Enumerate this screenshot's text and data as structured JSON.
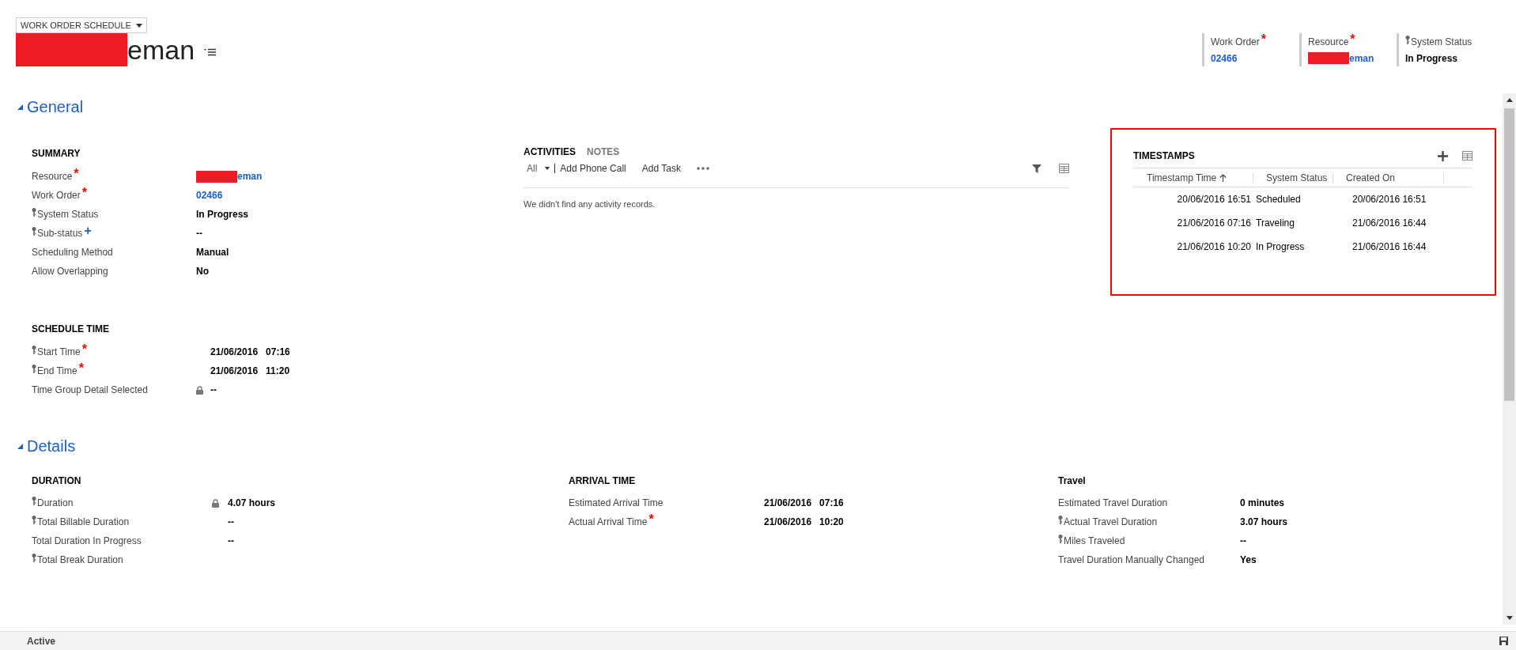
{
  "header": {
    "form_selector": "WORK ORDER SCHEDULE",
    "title": "eman",
    "title_redacted": true,
    "fields": [
      {
        "label": "Work Order",
        "mark": {
          "text": "*",
          "color": "#ff0000"
        },
        "key_icon": false,
        "value": "02466",
        "kind": "link",
        "redacted": false
      },
      {
        "label": "Resource",
        "mark": {
          "text": "*",
          "color": "#ff0000"
        },
        "key_icon": false,
        "value": "eman",
        "kind": "link",
        "redacted": true
      },
      {
        "label": "System Status",
        "key_icon": true,
        "value": "In Progress",
        "kind": "text",
        "redacted": false
      }
    ]
  },
  "general": {
    "title": "General",
    "expanded": true,
    "summary": {
      "title": "SUMMARY",
      "fields": [
        {
          "label": "Resource",
          "mark": {
            "text": "*",
            "color": "#ff0000"
          },
          "key_icon": false,
          "locked": false,
          "value": "eman",
          "kind": "link",
          "redacted": true
        },
        {
          "label": "Work Order",
          "mark": {
            "text": "*",
            "color": "#ff0000"
          },
          "key_icon": false,
          "locked": false,
          "value": "02466",
          "kind": "link",
          "redacted": false
        },
        {
          "label": "System Status",
          "key_icon": true,
          "locked": false,
          "value": "In Progress",
          "kind": "text",
          "redacted": false
        },
        {
          "label": "Sub-status",
          "mark": {
            "text": "+",
            "color": "#1e5ec8"
          },
          "key_icon": true,
          "locked": false,
          "value": "--",
          "kind": "text",
          "redacted": false
        },
        {
          "label": "Scheduling Method",
          "key_icon": false,
          "locked": false,
          "value": "Manual",
          "kind": "text",
          "redacted": false
        },
        {
          "label": "Allow Overlapping",
          "key_icon": false,
          "locked": false,
          "value": "No",
          "kind": "text",
          "redacted": false
        }
      ]
    },
    "schedule_time": {
      "title": "SCHEDULE TIME",
      "fields": [
        {
          "label": "Start Time",
          "mark": {
            "text": "*",
            "color": "#ff0000"
          },
          "key_icon": true,
          "locked": false,
          "value": "21/06/2016   07:16",
          "kind": "text",
          "redacted": false
        },
        {
          "label": "End Time",
          "mark": {
            "text": "*",
            "color": "#ff0000"
          },
          "key_icon": true,
          "locked": false,
          "value": "21/06/2016   11:20",
          "kind": "text",
          "redacted": false
        },
        {
          "label": "Time Group Detail Selected",
          "key_icon": false,
          "locked": true,
          "value": "--",
          "kind": "text",
          "redacted": false
        }
      ]
    },
    "activities": {
      "tabs": [
        {
          "label": "ACTIVITIES",
          "selected": true
        },
        {
          "label": "NOTES",
          "selected": false
        }
      ],
      "filter": "All",
      "actions": [
        "Add Phone Call",
        "Add Task"
      ],
      "empty_message": "We didn't find any activity records."
    },
    "timestamps": {
      "title": "TIMESTAMPS",
      "highlighted": true,
      "columns": [
        {
          "label": "Timestamp Time",
          "sorted": true
        },
        {
          "label": "System Status",
          "sorted": false
        },
        {
          "label": "Created On",
          "sorted": false
        }
      ],
      "rows": [
        [
          "20/06/2016 16:51",
          "Scheduled",
          "20/06/2016 16:51"
        ],
        [
          "21/06/2016 07:16",
          "Traveling",
          "21/06/2016 16:44"
        ],
        [
          "21/06/2016 10:20",
          "In Progress",
          "21/06/2016 16:44"
        ]
      ]
    }
  },
  "details": {
    "title": "Details",
    "expanded": true,
    "sections": [
      {
        "title": "DURATION",
        "fields": [
          {
            "label": "Duration",
            "key_icon": true,
            "locked": true,
            "value": "4.07 hours",
            "kind": "text",
            "redacted": false
          },
          {
            "label": "Total Billable Duration",
            "key_icon": true,
            "locked": false,
            "value": "--",
            "kind": "text",
            "redacted": false
          },
          {
            "label": "Total Duration In Progress",
            "key_icon": false,
            "locked": false,
            "value": "--",
            "kind": "text",
            "redacted": false
          },
          {
            "label": "Total Break Duration",
            "key_icon": true,
            "locked": false,
            "redacted": false
          }
        ]
      },
      {
        "title": "ARRIVAL TIME",
        "fields": [
          {
            "label": "Estimated Arrival Time",
            "key_icon": false,
            "locked": false,
            "value": "21/06/2016   07:16",
            "kind": "text",
            "redacted": false
          },
          {
            "label": "Actual Arrival Time",
            "mark": {
              "text": "*",
              "color": "#ff0000"
            },
            "key_icon": false,
            "locked": false,
            "value": "21/06/2016   10:20",
            "kind": "text",
            "redacted": false
          }
        ]
      },
      {
        "title": "Travel",
        "fields": [
          {
            "label": "Estimated Travel Duration",
            "key_icon": false,
            "locked": false,
            "value": "0 minutes",
            "kind": "text",
            "redacted": false
          },
          {
            "label": "Actual Travel Duration",
            "key_icon": true,
            "locked": false,
            "value": "3.07 hours",
            "kind": "text",
            "redacted": false
          },
          {
            "label": "Miles Traveled",
            "key_icon": true,
            "locked": false,
            "value": "--",
            "kind": "text",
            "redacted": false
          },
          {
            "label": "Travel Duration Manually Changed",
            "key_icon": false,
            "locked": false,
            "value": "Yes",
            "kind": "text",
            "redacted": false
          }
        ]
      }
    ]
  },
  "status_bar": {
    "status": "Active"
  }
}
